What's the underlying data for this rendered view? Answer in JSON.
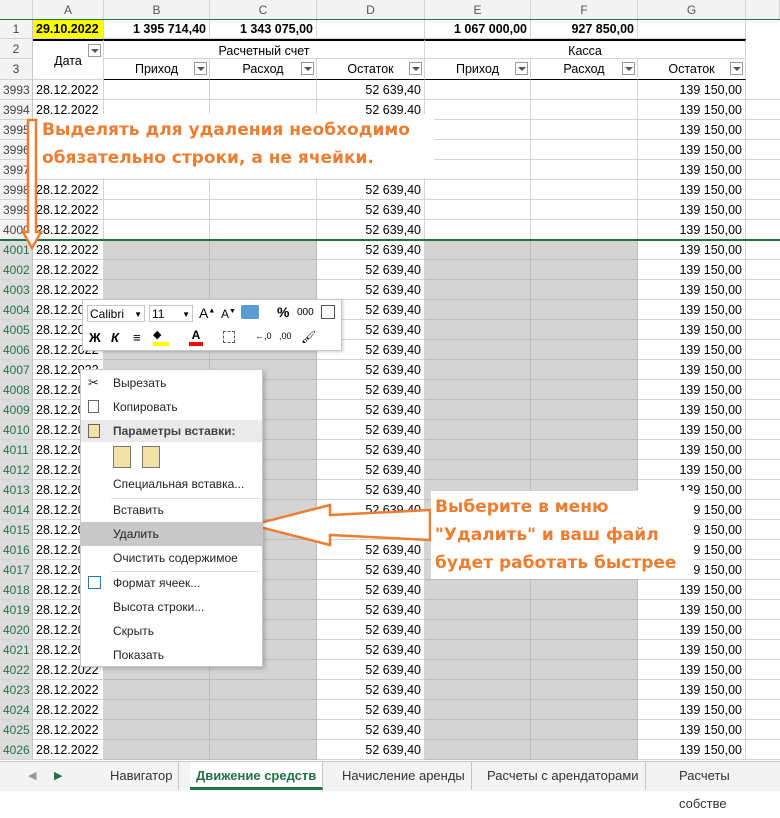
{
  "columns": [
    "A",
    "B",
    "C",
    "D",
    "E",
    "F",
    "G"
  ],
  "row1": {
    "num": "1",
    "a": "29.10.2022",
    "b": "1 395 714,40",
    "c": "1 343 075,00",
    "d": "",
    "e": "1 067 000,00",
    "f": "927 850,00",
    "g": ""
  },
  "row2": {
    "num": "2",
    "group1": "Расчетный счет",
    "group2": "Касса"
  },
  "row3": {
    "num": "3"
  },
  "headers": {
    "date": "Дата",
    "in1": "Приход",
    "out1": "Расход",
    "bal1": "Остаток",
    "in2": "Приход",
    "out2": "Расход",
    "bal2": "Остаток"
  },
  "rows": [
    {
      "num": "3993",
      "date": "28.12.2022",
      "bal1": "52 639,40",
      "bal2": "139 150,00"
    },
    {
      "num": "3994",
      "date": "28.12.2022",
      "bal1": "52 639,40",
      "bal2": "139 150,00"
    },
    {
      "num": "3995",
      "date": "",
      "bal1": "",
      "bal2": "139 150,00"
    },
    {
      "num": "3996",
      "date": "",
      "bal1": "",
      "bal2": "139 150,00"
    },
    {
      "num": "3997",
      "date": "",
      "bal1": "",
      "bal2": "139 150,00"
    },
    {
      "num": "3998",
      "date": "28.12.2022",
      "bal1": "52 639,40",
      "bal2": "139 150,00"
    },
    {
      "num": "3999",
      "date": "28.12.2022",
      "bal1": "52 639,40",
      "bal2": "139 150,00"
    },
    {
      "num": "4000",
      "date": "28.12.2022",
      "bal1": "52 639,40",
      "bal2": "139 150,00"
    },
    {
      "num": "4001",
      "date": "28.12.2022",
      "bal1": "52 639,40",
      "bal2": "139 150,00"
    },
    {
      "num": "4002",
      "date": "28.12.2022",
      "bal1": "52 639,40",
      "bal2": "139 150,00"
    },
    {
      "num": "4003",
      "date": "28.12.2022",
      "bal1": "52 639,40",
      "bal2": "139 150,00"
    },
    {
      "num": "4004",
      "date": "28.12.2022",
      "bal1": "52 639,40",
      "bal2": "139 150,00"
    },
    {
      "num": "4005",
      "date": "28.12.2022",
      "bal1": "52 639,40",
      "bal2": "139 150,00"
    },
    {
      "num": "4006",
      "date": "28.12.2022",
      "bal1": "52 639,40",
      "bal2": "139 150,00"
    },
    {
      "num": "4007",
      "date": "28.12.2022",
      "bal1": "52 639,40",
      "bal2": "139 150,00"
    },
    {
      "num": "4008",
      "date": "28.12.2022",
      "bal1": "52 639,40",
      "bal2": "139 150,00"
    },
    {
      "num": "4009",
      "date": "28.12.2022",
      "bal1": "52 639,40",
      "bal2": "139 150,00"
    },
    {
      "num": "4010",
      "date": "28.12.2022",
      "bal1": "52 639,40",
      "bal2": "139 150,00"
    },
    {
      "num": "4011",
      "date": "28.12.2022",
      "bal1": "52 639,40",
      "bal2": "139 150,00"
    },
    {
      "num": "4012",
      "date": "28.12.2022",
      "bal1": "52 639,40",
      "bal2": "139 150,00"
    },
    {
      "num": "4013",
      "date": "28.12.2022",
      "bal1": "52 639,40",
      "bal2": "139 150,00"
    },
    {
      "num": "4014",
      "date": "28.12.2022",
      "bal1": "52 639,40",
      "bal2": "139 150,00"
    },
    {
      "num": "4015",
      "date": "28.12.2022",
      "bal1": "52 639,40",
      "bal2": "139 150,00"
    },
    {
      "num": "4016",
      "date": "28.12.2022",
      "bal1": "52 639,40",
      "bal2": "139 150,00"
    },
    {
      "num": "4017",
      "date": "28.12.2022",
      "bal1": "52 639,40",
      "bal2": "139 150,00"
    },
    {
      "num": "4018",
      "date": "28.12.2022",
      "bal1": "52 639,40",
      "bal2": "139 150,00"
    },
    {
      "num": "4019",
      "date": "28.12.2022",
      "bal1": "52 639,40",
      "bal2": "139 150,00"
    },
    {
      "num": "4020",
      "date": "28.12.2022",
      "bal1": "52 639,40",
      "bal2": "139 150,00"
    },
    {
      "num": "4021",
      "date": "28.12.2022",
      "bal1": "52 639,40",
      "bal2": "139 150,00"
    },
    {
      "num": "4022",
      "date": "28.12.2022",
      "bal1": "52 639,40",
      "bal2": "139 150,00"
    },
    {
      "num": "4023",
      "date": "28.12.2022",
      "bal1": "52 639,40",
      "bal2": "139 150,00"
    },
    {
      "num": "4024",
      "date": "28.12.2022",
      "bal1": "52 639,40",
      "bal2": "139 150,00"
    },
    {
      "num": "4025",
      "date": "28.12.2022",
      "bal1": "52 639,40",
      "bal2": "139 150,00"
    },
    {
      "num": "4026",
      "date": "28.12.2022",
      "bal1": "52 639,40",
      "bal2": "139 150,00"
    }
  ],
  "annotations": {
    "top": "Выделять для удаления необходимо обязательно строки, а не ячейки.",
    "bottom": "Выберите в меню \"Удалить\" и ваш файл будет работать быстрее"
  },
  "minitoolbar": {
    "font": "Calibri",
    "size": "11",
    "percent": "%",
    "thousands": "000",
    "bold": "Ж",
    "italic": "К"
  },
  "context_menu": {
    "cut": "Вырезать",
    "copy": "Копировать",
    "paste_options": "Параметры вставки:",
    "paste_special": "Специальная вставка...",
    "insert": "Вставить",
    "delete": "Удалить",
    "clear": "Очистить содержимое",
    "format": "Формат ячеек...",
    "row_height": "Высота строки...",
    "hide": "Скрыть",
    "show": "Показать"
  },
  "tabs": [
    "Навигатор",
    "Движение средств",
    "Начисление аренды",
    "Расчеты с арендаторами",
    "Расчеты собстве"
  ],
  "colors": {
    "accent": "#217346",
    "annotation": "#ed7d31",
    "date_highlight": "#ffff00",
    "selection": "#d4d4d4"
  }
}
